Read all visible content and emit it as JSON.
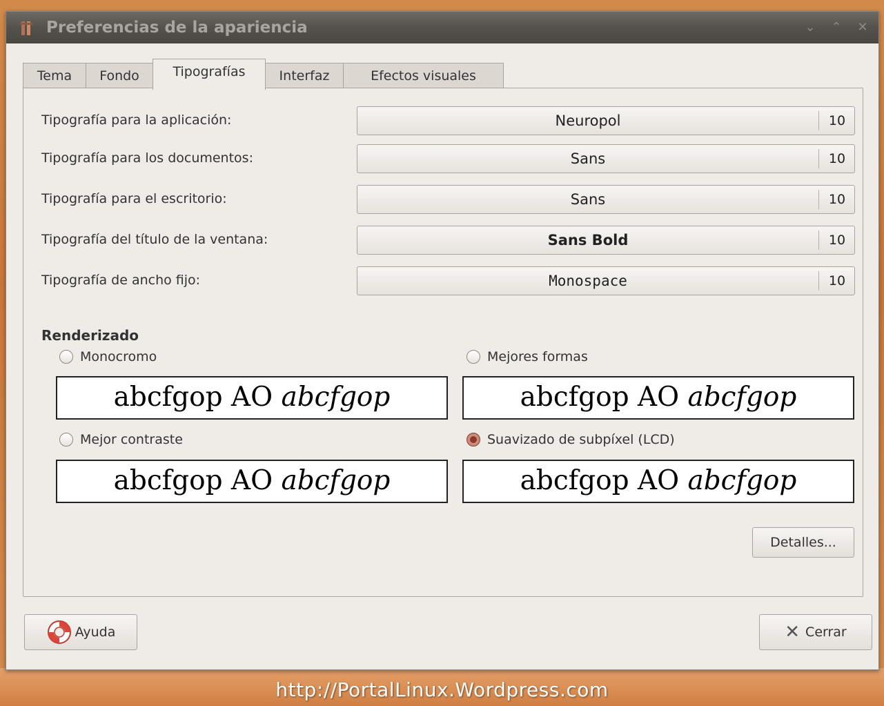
{
  "window": {
    "title": "Preferencias de la apariencia"
  },
  "tabs": [
    {
      "label": "Tema",
      "active": false
    },
    {
      "label": "Fondo",
      "active": false
    },
    {
      "label": "Tipografías",
      "active": true
    },
    {
      "label": "Interfaz",
      "active": false
    },
    {
      "label": "Efectos visuales",
      "active": false
    }
  ],
  "fonts": [
    {
      "label": "Tipografía para la aplicación:",
      "font": "Neuropol",
      "size": "10"
    },
    {
      "label": "Tipografía para los documentos:",
      "font": "Sans",
      "size": "10"
    },
    {
      "label": "Tipografía para el escritorio:",
      "font": "Sans",
      "size": "10"
    },
    {
      "label": "Tipografía del título de la ventana:",
      "font": "Sans Bold",
      "size": "10"
    },
    {
      "label": "Tipografía de ancho fijo:",
      "font": "Monospace",
      "size": "10"
    }
  ],
  "rendering": {
    "title": "Renderizado",
    "options": [
      {
        "label": "Monocromo",
        "selected": false
      },
      {
        "label": "Mejores formas",
        "selected": false
      },
      {
        "label": "Mejor contraste",
        "selected": false
      },
      {
        "label": "Suavizado de subpíxel (LCD)",
        "selected": true
      }
    ],
    "sample": {
      "regular": "abcfgop AO ",
      "italic": "abcfgop"
    }
  },
  "buttons": {
    "details": "Detalles...",
    "help": "Ayuda",
    "close": "Cerrar"
  },
  "watermark": "http://PortalLinux.Wordpress.com",
  "colors": {
    "selected_radio": "#8b3a2a",
    "titlebar": "#55524d"
  }
}
